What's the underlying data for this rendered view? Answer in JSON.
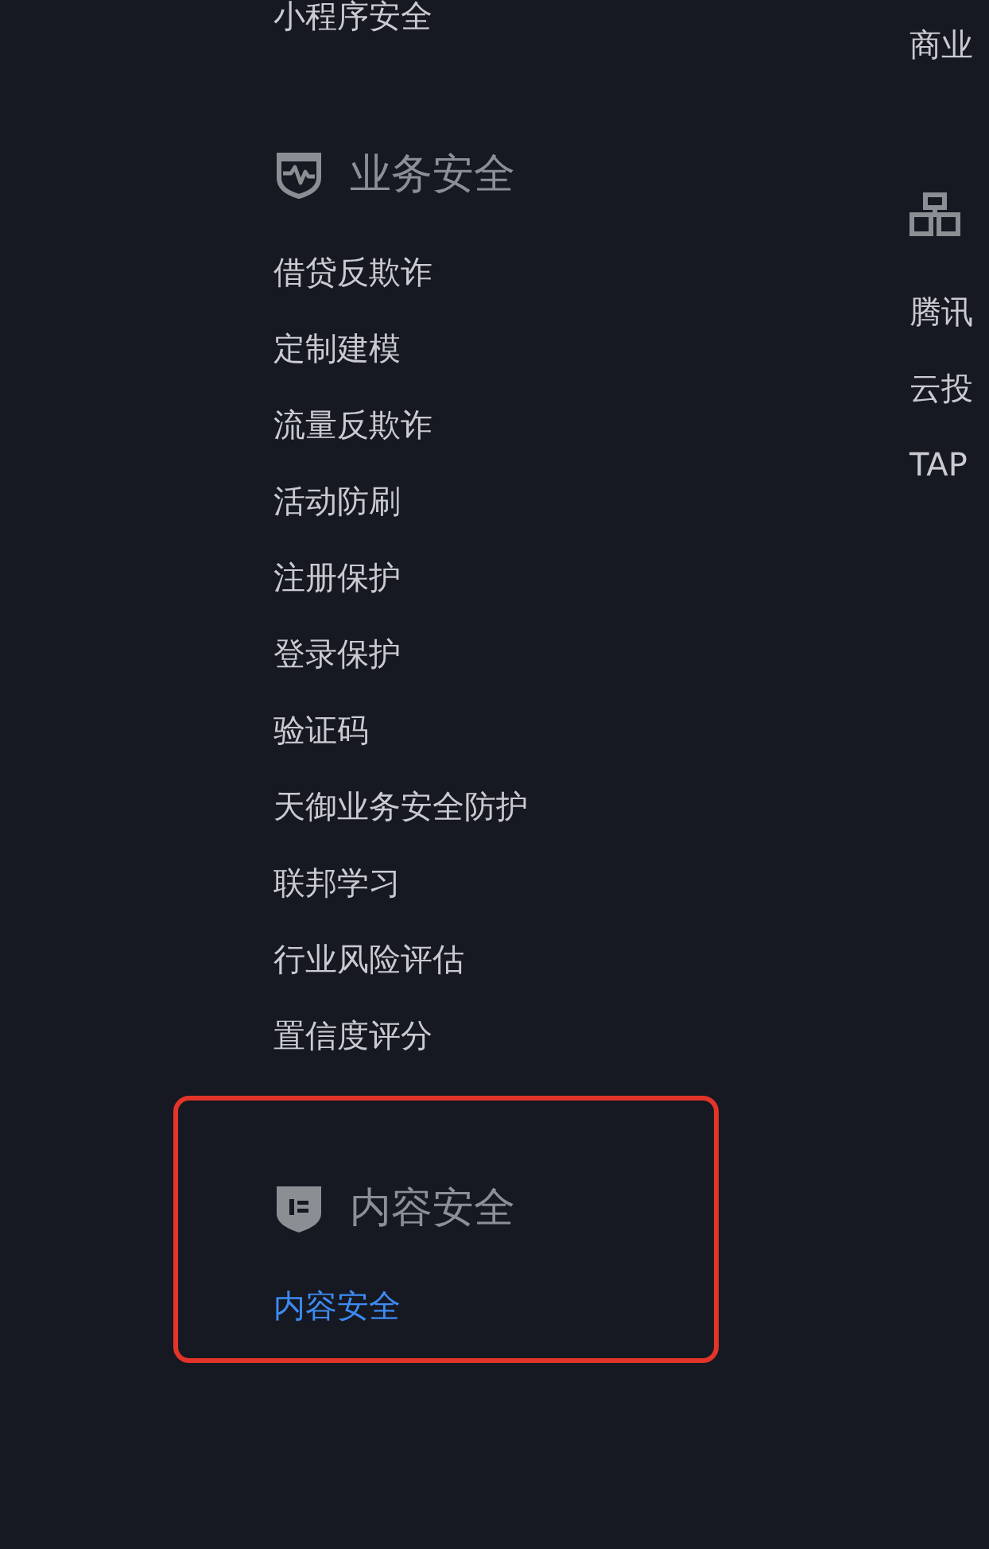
{
  "left_column": {
    "items": [
      {
        "label": "小程序安全",
        "selected": false
      }
    ],
    "sections": [
      {
        "title": "业务安全",
        "highlighted": false,
        "items": [
          {
            "label": "借贷反欺诈",
            "selected": false
          },
          {
            "label": "定制建模",
            "selected": false
          },
          {
            "label": "流量反欺诈",
            "selected": false
          },
          {
            "label": "活动防刷",
            "selected": false
          },
          {
            "label": "注册保护",
            "selected": false
          },
          {
            "label": "登录保护",
            "selected": false
          },
          {
            "label": "验证码",
            "selected": false
          },
          {
            "label": "天御业务安全防护",
            "selected": false
          },
          {
            "label": "联邦学习",
            "selected": false
          },
          {
            "label": "行业风险评估",
            "selected": false
          },
          {
            "label": "置信度评分",
            "selected": false
          }
        ]
      },
      {
        "title": "内容安全",
        "highlighted": true,
        "items": [
          {
            "label": "内容安全",
            "selected": true
          }
        ]
      }
    ]
  },
  "right_column": {
    "items": [
      {
        "label": "商业",
        "selected": false
      }
    ],
    "sections": [
      {
        "highlighted": false,
        "items": [
          {
            "label": "腾讯",
            "selected": false
          },
          {
            "label": "云投",
            "selected": false
          },
          {
            "label": "TAP",
            "selected": false
          }
        ]
      }
    ]
  }
}
